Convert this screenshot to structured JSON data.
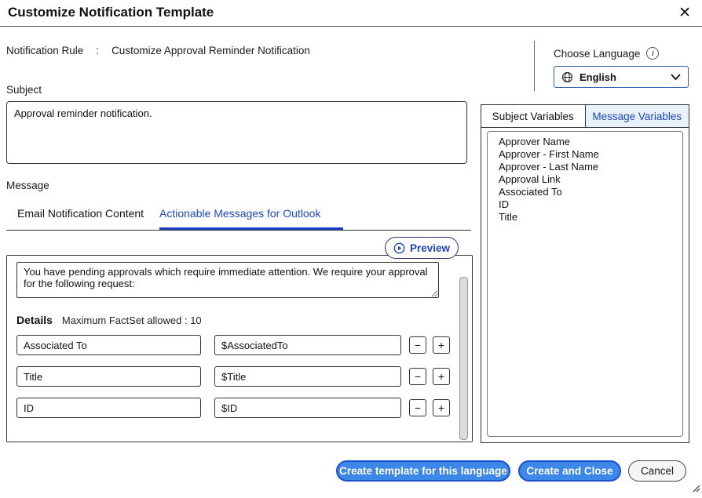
{
  "window": {
    "title": "Customize Notification Template",
    "close_glyph": "✕"
  },
  "rule": {
    "label": "Notification Rule",
    "colon": ":",
    "value": "Customize Approval Reminder Notification"
  },
  "language": {
    "label": "Choose Language",
    "selected": "English"
  },
  "subject": {
    "label": "Subject",
    "value": "Approval reminder notification."
  },
  "message": {
    "label": "Message",
    "tabs": [
      {
        "label": "Email Notification Content"
      },
      {
        "label": "Actionable Messages for Outlook"
      }
    ],
    "preview_label": "Preview",
    "body": "You have pending approvals which require immediate attention. We require your approval for the following request:",
    "details": {
      "label": "Details",
      "hint": "Maximum FactSet allowed : 10",
      "remove_glyph": "−",
      "add_glyph": "+",
      "rows": [
        {
          "name": "Associated To",
          "variable": "$AssociatedTo"
        },
        {
          "name": "Title",
          "variable": "$Title"
        },
        {
          "name": "ID",
          "variable": "$ID"
        }
      ]
    }
  },
  "variables_panel": {
    "tabs": [
      {
        "label": "Subject Variables"
      },
      {
        "label": "Message Variables"
      }
    ],
    "items": [
      "Approver Name",
      "Approver - First Name",
      "Approver - Last Name",
      "Approval Link",
      "Associated To",
      "ID",
      "Title"
    ]
  },
  "footer": {
    "create_language_label": "Create template for this language",
    "create_close_label": "Create and Close",
    "cancel_label": "Cancel"
  },
  "colors": {
    "accent_blue": "#1b46c8",
    "active_tab_bg": "#e9f1fb",
    "primary_button_fill": "#3d87e8",
    "primary_button_border": "#1d4ed0",
    "border_dark": "#333333"
  }
}
